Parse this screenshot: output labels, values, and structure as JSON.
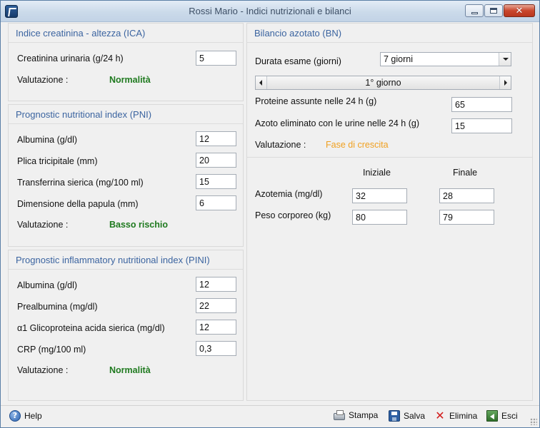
{
  "window": {
    "title": "Rossi Mario - Indici nutrizionali e bilanci",
    "icon": "app-icon",
    "buttons": [
      "minimize-icon",
      "maximize-icon",
      "close-icon"
    ],
    "close_glyph": "✕"
  },
  "ica": {
    "title": "Indice creatinina - altezza (ICA)",
    "fields": [
      {
        "label": "Creatinina urinaria (g/24 h)",
        "value": "5"
      }
    ],
    "evaluation_label": "Valutazione :",
    "evaluation_value": "Normalità",
    "evaluation_color": "#1f7a1f"
  },
  "pni": {
    "title": "Prognostic nutritional index (PNI)",
    "fields": [
      {
        "label": "Albumina (g/dl)",
        "value": "12"
      },
      {
        "label": "Plica tricipitale (mm)",
        "value": "20"
      },
      {
        "label": "Transferrina sierica (mg/100 ml)",
        "value": "15"
      },
      {
        "label": "Dimensione della papula (mm)",
        "value": "6"
      }
    ],
    "evaluation_label": "Valutazione :",
    "evaluation_value": "Basso rischio",
    "evaluation_color": "#1f7a1f"
  },
  "pini": {
    "title": "Prognostic inflammatory nutritional index (PINI)",
    "fields": [
      {
        "label": "Albumina (g/dl)",
        "value": "12"
      },
      {
        "label": "Prealbumina (mg/dl)",
        "value": "22"
      },
      {
        "label": "α1 Glicoproteina acida sierica (mg/dl)",
        "value": "12"
      },
      {
        "label": "CRP (mg/100 ml)",
        "value": "0,3"
      }
    ],
    "evaluation_label": "Valutazione :",
    "evaluation_value": "Normalità",
    "evaluation_color": "#1f7a1f"
  },
  "bn": {
    "title": "Bilancio azotato (BN)",
    "duration_label": "Durata esame (giorni)",
    "duration_value": "7 giorni",
    "day_stepper": "1° giorno",
    "fields": [
      {
        "label": "Proteine assunte nelle 24 h (g)",
        "value": "65"
      },
      {
        "label": "Azoto eliminato con le urine nelle 24 h (g)",
        "value": "15"
      }
    ],
    "evaluation_label": "Valutazione :",
    "evaluation_value": "Fase di crescita",
    "evaluation_color": "#f0a020",
    "columns": [
      "Iniziale",
      "Finale"
    ],
    "rows": [
      {
        "label": "Azotemia (mg/dl)",
        "initial": "32",
        "final": "28"
      },
      {
        "label": "Peso corporeo (kg)",
        "initial": "80",
        "final": "79"
      }
    ]
  },
  "toolbar": {
    "help": "Help",
    "print": "Stampa",
    "save": "Salva",
    "delete": "Elimina",
    "exit": "Esci",
    "help_glyph": "?",
    "delete_glyph": "✕"
  }
}
